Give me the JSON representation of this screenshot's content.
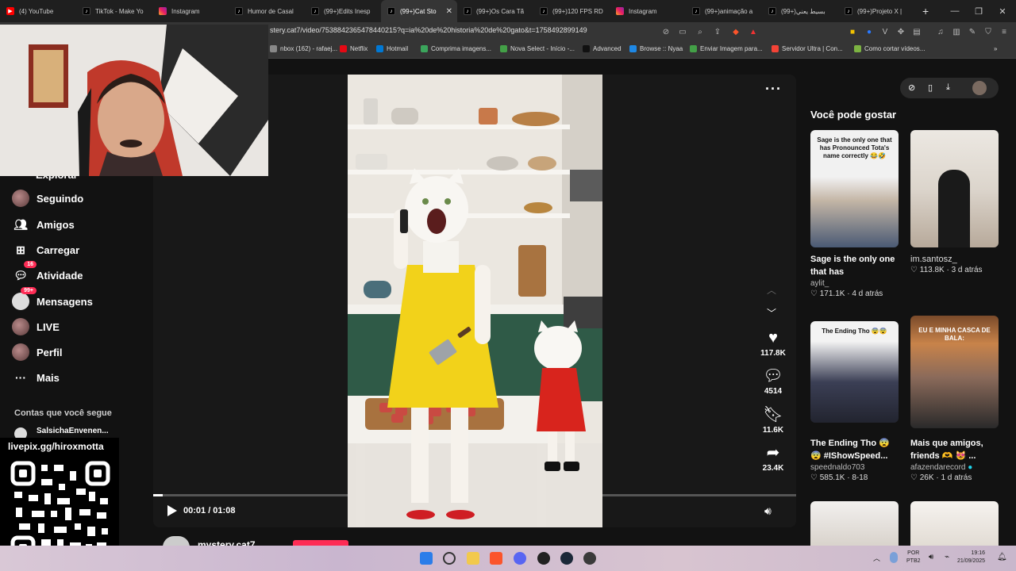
{
  "browser": {
    "tabs": [
      {
        "label": "(4) YouTube",
        "icon": "youtube-icon"
      },
      {
        "label": "TikTok - Make Yo",
        "icon": "tiktok-icon"
      },
      {
        "label": "Instagram",
        "icon": "instagram-icon"
      },
      {
        "label": "Humor de Casal",
        "icon": "tiktok-icon"
      },
      {
        "label": "(99+)Edits Inesp",
        "icon": "tiktok-icon"
      },
      {
        "label": "(99+)Cat Sto",
        "icon": "tiktok-icon",
        "active": true
      },
      {
        "label": "(99+)Os Cara Tã",
        "icon": "tiktok-icon"
      },
      {
        "label": "(99+)120 FPS RD",
        "icon": "tiktok-icon"
      },
      {
        "label": "Instagram",
        "icon": "instagram-icon"
      },
      {
        "label": "(99+)animação a",
        "icon": "tiktok-icon"
      },
      {
        "label": "(99+)بسيط يعني",
        "icon": "tiktok-icon"
      },
      {
        "label": "(99+)Projeto X |",
        "icon": "tiktok-icon"
      }
    ],
    "new_tab": "+",
    "url": "stery.cat7/video/7538842365478440215?q=ia%20de%20historia%20de%20gato&t=1758492899149",
    "bookmarks": [
      "nbox (162) - rafaej...",
      "Netflix",
      "Hotmail",
      "Comprima imagens...",
      "Nova Select - Início -...",
      "Advanced",
      "Browse :: Nyaa",
      "Enviar Imagem para...",
      "Servidor Ultra | Con...",
      "Como cortar vídeos..."
    ],
    "bookmark_colors": [
      "#888888",
      "#e50914",
      "#0078d4",
      "#3ba55c",
      "#43a047",
      "#111111",
      "#1e88e5",
      "#43a047",
      "#f44336",
      "#7cb342"
    ]
  },
  "sidebar": {
    "partial_item": "Explorar",
    "items": [
      {
        "label": "Seguindo",
        "icon": "following-avatar-icon"
      },
      {
        "label": "Amigos",
        "icon": "friends-icon"
      },
      {
        "label": "Carregar",
        "icon": "upload-icon"
      },
      {
        "label": "Atividade",
        "icon": "activity-icon",
        "badge": "16"
      },
      {
        "label": "Mensagens",
        "icon": "messages-icon",
        "badge": "99+"
      },
      {
        "label": "LIVE",
        "icon": "live-icon"
      },
      {
        "label": "Perfil",
        "icon": "profile-icon"
      },
      {
        "label": "Mais",
        "icon": "more-icon"
      }
    ],
    "following_header": "Contas que você segue",
    "following": [
      "SalsichaEnvenen..."
    ]
  },
  "overlay": {
    "pix": "livepix.gg/hiroxmotta"
  },
  "video": {
    "time": "00:01 / 01:08",
    "progress": 0.015,
    "author": "mystery.cat7",
    "actions": [
      {
        "name": "like",
        "count": "117.8K"
      },
      {
        "name": "comment",
        "count": "4514"
      },
      {
        "name": "save",
        "count": "11.6K"
      },
      {
        "name": "share",
        "count": "23.4K"
      }
    ]
  },
  "suggestions": {
    "title": "Você pode gostar",
    "cards": [
      {
        "caption": "Sage is the only one that has Pronounce...",
        "author": "aylit_",
        "likes": "171.1K",
        "age": "4 d atrás",
        "thumb_text": "Sage is the only one that has Pronounced Tota's name correctly 😂🤣"
      },
      {
        "caption": "im.santosz_",
        "author": "",
        "likes": "113.8K",
        "age": "3 d atrás",
        "thumb_text": ""
      },
      {
        "caption": "The Ending Tho 😨 😨 #IShowSpeed...",
        "author": "speednaldo703",
        "likes": "585.1K",
        "age": "8-18",
        "thumb_text": "The Ending Tho 😨😨"
      },
      {
        "caption": "Mais que amigos, friends 🫶 😻 ...",
        "author": "afazendarecord",
        "likes": "26K",
        "age": "1 d atrás",
        "thumb_text": "EU E MINHA CASCA DE BALA:"
      }
    ]
  },
  "taskbar": {
    "lang": "POR",
    "layout": "PTB2",
    "time": "19:16",
    "date": "21/09/2025"
  }
}
